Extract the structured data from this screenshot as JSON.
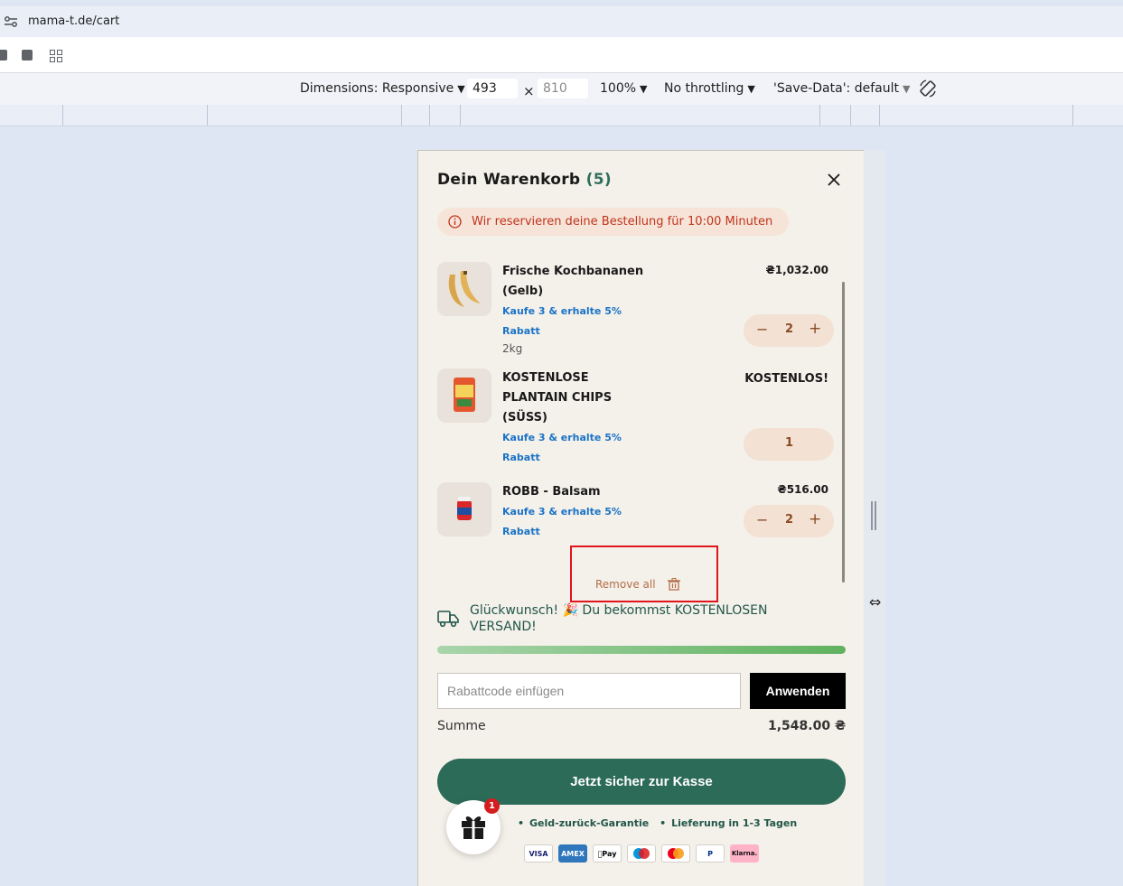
{
  "browser": {
    "url": "mama-t.de/cart"
  },
  "device_toolbar": {
    "dimensions_label": "Dimensions: Responsive",
    "width": "493",
    "times": "×",
    "height_placeholder": "810",
    "zoom": "100%",
    "throttling": "No throttling",
    "save_data": "'Save-Data': default"
  },
  "cart": {
    "title": "Dein Warenkorb",
    "count": "(5)",
    "reservation_notice": "Wir reservieren deine Bestellung für 10:00 Minuten",
    "items": [
      {
        "name_line1": "Frische Kochbananen",
        "name_line2": "(Gelb)",
        "promo_line1": "Kaufe 3 & erhalte 5%",
        "promo_line2": "Rabatt",
        "variant": "2kg",
        "price": "₴1,032.00",
        "quantity": "2"
      },
      {
        "name_line1": "KOSTENLOSE",
        "name_line2": "PLANTAIN CHIPS",
        "name_line3": "(SÜSS)",
        "promo_line1": "Kaufe 3 & erhalte 5%",
        "promo_line2": "Rabatt",
        "price": "KOSTENLOS!",
        "quantity": "1"
      },
      {
        "name_line1": "ROBB - Balsam",
        "promo_line1": "Kaufe 3 & erhalte 5%",
        "promo_line2": "Rabatt",
        "price": "₴516.00",
        "quantity": "2"
      }
    ],
    "remove_all": "Remove all",
    "shipping_message": "Glückwunsch! 🎉 Du bekommst KOSTENLOSEN VERSAND!",
    "shipping_progress": 1.0,
    "coupon_placeholder": "Rabattcode einfügen",
    "apply_label": "Anwenden",
    "sum_label": "Summe",
    "sum_value": "1,548.00 ₴",
    "checkout_label": "Jetzt sicher zur Kasse",
    "guarantee1": "Geld-zurück-Garantie",
    "guarantee2": "Lieferung in 1-3 Tagen",
    "gift_badge_count": "1",
    "payment_methods": [
      "VISA",
      "AMEX",
      "Pay",
      "maestro",
      "mastercard",
      "PayPal",
      "Klarna."
    ],
    "minus": "−",
    "plus": "+",
    "bullet": "•"
  },
  "colors": {
    "brand_green": "#2d6b59",
    "promo_blue": "#1a73c7",
    "notice_red": "#c0341d",
    "panel_bg": "#f4f0ea",
    "highlight_red": "#e0161c"
  }
}
